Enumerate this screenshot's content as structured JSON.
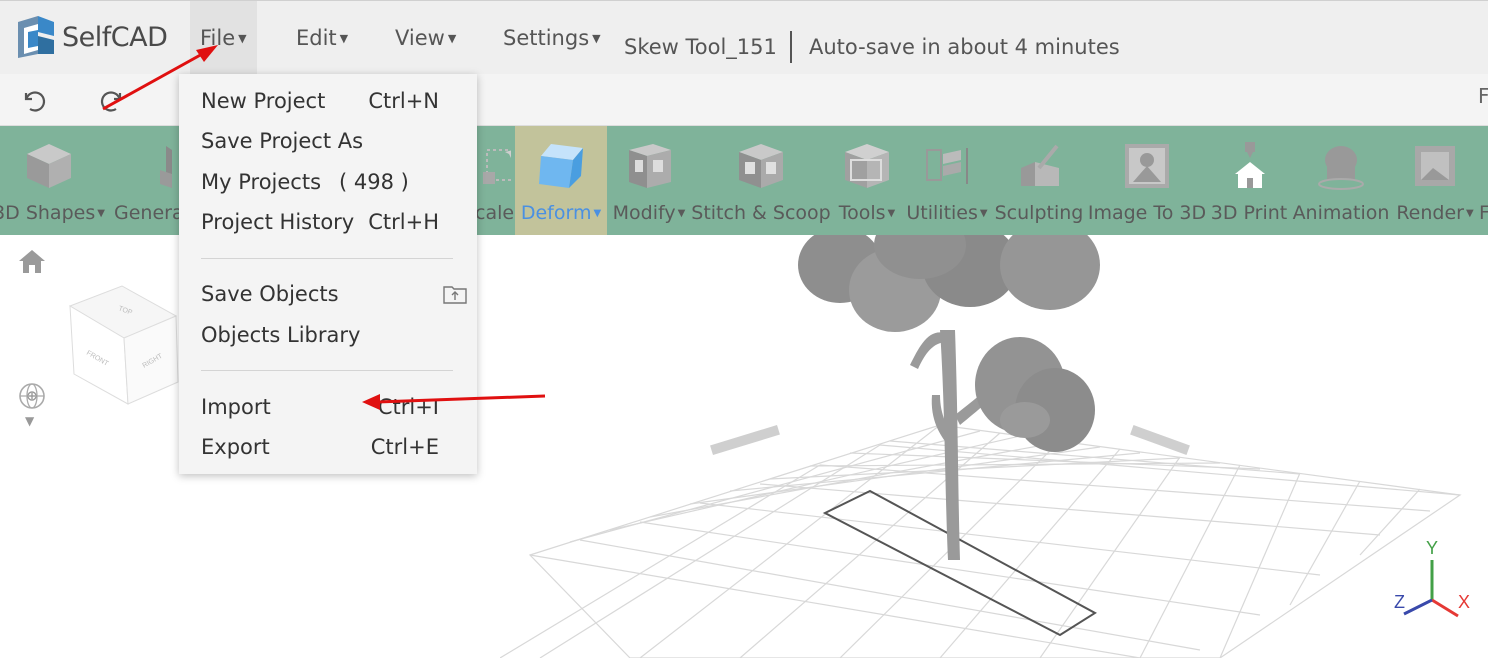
{
  "app": {
    "name": "SelfCAD",
    "document_title": "Skew Tool_151",
    "autosave_status": "Auto-save in about 4 minutes",
    "accent_color": "#7fb39a"
  },
  "menubar": {
    "items": [
      {
        "label": "File",
        "active": true
      },
      {
        "label": "Edit"
      },
      {
        "label": "View"
      },
      {
        "label": "Settings"
      }
    ]
  },
  "subbar": {
    "undo_icon": "undo-icon",
    "redo_icon": "redo-icon",
    "right_text": "F"
  },
  "ribbon": {
    "tools": [
      {
        "label": "3D Shapes",
        "dropdown": true
      },
      {
        "label": "Genera"
      },
      {
        "label": "cale"
      },
      {
        "label": "Deform",
        "dropdown": true,
        "active": true
      },
      {
        "label": "Modify",
        "dropdown": true
      },
      {
        "label": "Stitch & Scoop"
      },
      {
        "label": "Tools",
        "dropdown": true
      },
      {
        "label": "Utilities",
        "dropdown": true
      },
      {
        "label": "Sculpting"
      },
      {
        "label": "Image To 3D"
      },
      {
        "label": "3D Print"
      },
      {
        "label": "Animation"
      },
      {
        "label": "Render",
        "dropdown": true
      },
      {
        "label": "F"
      }
    ]
  },
  "file_menu": {
    "groups": [
      [
        {
          "label": "New Project",
          "shortcut": "Ctrl+N"
        },
        {
          "label": "Save Project As",
          "shortcut": ""
        },
        {
          "label": "My Projects",
          "count": "( 498 )"
        },
        {
          "label": "Project History",
          "shortcut": "Ctrl+H"
        }
      ],
      [
        {
          "label": "Save Objects",
          "icon": "folder-upload-icon"
        },
        {
          "label": "Objects Library",
          "shortcut": ""
        }
      ],
      [
        {
          "label": "Import",
          "shortcut": "Ctrl+I"
        },
        {
          "label": "Export",
          "shortcut": "Ctrl+E"
        }
      ]
    ]
  },
  "view_cube": {
    "faces": [
      "TOP",
      "FRONT",
      "RIGHT"
    ]
  },
  "axis_gizmo": {
    "x": "X",
    "y": "Y",
    "z": "Z",
    "x_color": "#e53935",
    "y_color": "#43a047",
    "z_color": "#3949ab"
  },
  "annotations": {
    "arrow_color": "#e01010"
  }
}
